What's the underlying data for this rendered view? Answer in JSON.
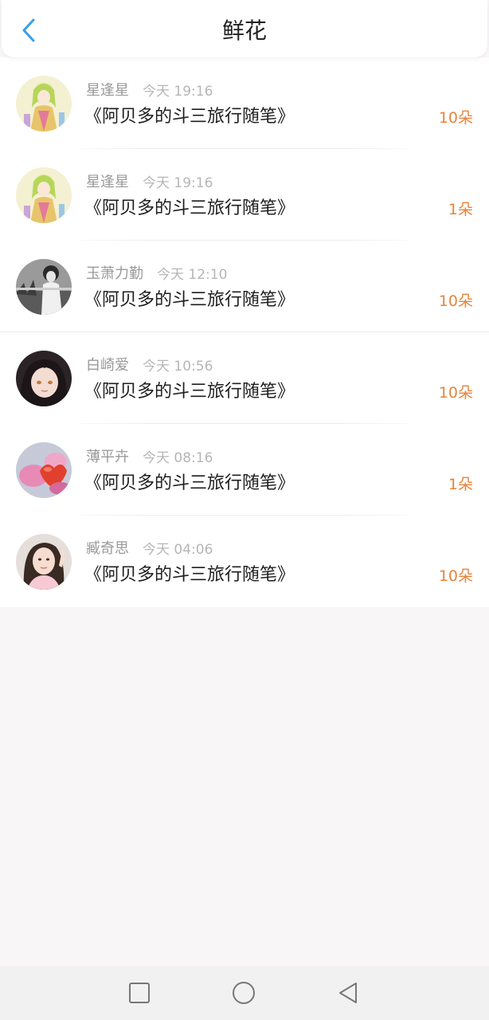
{
  "header": {
    "title": "鲜花",
    "back_icon": "chevron-left-icon",
    "accent_color": "#3a9ee8"
  },
  "flowers": [
    {
      "user": "星逢星",
      "time": "今天 19:16",
      "book": "《阿贝多的斗三旅行随笔》",
      "count": "10朵"
    },
    {
      "user": "星逢星",
      "time": "今天 19:16",
      "book": "《阿贝多的斗三旅行随笔》",
      "count": "1朵"
    },
    {
      "user": "玉萧力勤",
      "time": "今天 12:10",
      "book": "《阿贝多的斗三旅行随笔》",
      "count": "10朵"
    },
    {
      "user": "白崎爱",
      "time": "今天 10:56",
      "book": "《阿贝多的斗三旅行随笔》",
      "count": "10朵"
    },
    {
      "user": "薄平卉",
      "time": "今天 08:16",
      "book": "《阿贝多的斗三旅行随笔》",
      "count": "1朵"
    },
    {
      "user": "臧奇思",
      "time": "今天 04:06",
      "book": "《阿贝多的斗三旅行随笔》",
      "count": "10朵"
    }
  ],
  "colors": {
    "count": "#e8843a",
    "username": "#9a9a9a",
    "time": "#b6b6b6",
    "background": "#f8f6f7"
  },
  "system_nav": {
    "recents_icon": "square-icon",
    "home_icon": "circle-icon",
    "back_icon": "triangle-back-icon"
  }
}
